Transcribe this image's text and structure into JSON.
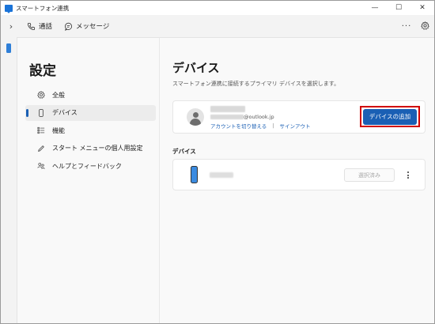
{
  "window": {
    "title": "スマートフォン連携",
    "controls": {
      "minimize": "—",
      "maximize": "☐",
      "close": "✕"
    }
  },
  "toolbar": {
    "expand": "›",
    "calls_label": "通話",
    "messages_label": "メッセージ",
    "more": "···"
  },
  "sidebar": {
    "title": "設定",
    "items": [
      {
        "label": "全般",
        "icon": "gear-icon"
      },
      {
        "label": "デバイス",
        "icon": "phone-icon",
        "active": true
      },
      {
        "label": "機能",
        "icon": "list-icon"
      },
      {
        "label": "スタート メニューの個人用設定",
        "icon": "pen-icon"
      },
      {
        "label": "ヘルプとフィードバック",
        "icon": "people-icon"
      }
    ]
  },
  "main": {
    "title": "デバイス",
    "description": "スマートフォン連携に接続するプライマリ デバイスを選択します。",
    "account": {
      "email_domain": "@outlook.jp",
      "switch_account": "アカウントを切り替える",
      "separator": "|",
      "sign_out": "サインアウト",
      "add_device": "デバイスの追加"
    },
    "devices_heading": "デバイス",
    "device": {
      "selected_label": "選択済み"
    }
  },
  "colors": {
    "accent": "#1a5fb4",
    "highlight": "#d00000",
    "link": "#1a5fb4"
  }
}
